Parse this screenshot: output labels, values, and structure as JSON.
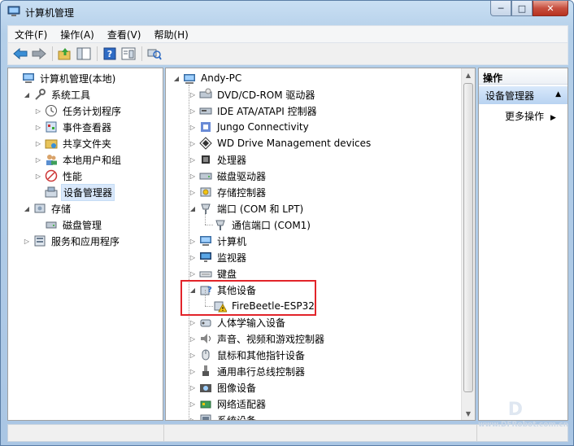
{
  "window": {
    "title": "计算机管理",
    "minimize": "─",
    "maximize": "□",
    "close": "✕"
  },
  "menu": [
    "文件(F)",
    "操作(A)",
    "查看(V)",
    "帮助(H)"
  ],
  "toolbar_icons": [
    "back-arrow-icon",
    "forward-arrow-icon",
    "up-folder-icon",
    "show-hide-tree-icon",
    "help-icon",
    "properties-icon",
    "scan-hardware-icon"
  ],
  "left_tree": [
    {
      "label": "计算机管理(本地)",
      "icon": "computer-management-icon",
      "level": 0,
      "expander": ""
    },
    {
      "label": "系统工具",
      "icon": "system-tools-icon",
      "level": 1,
      "expander": "expanded"
    },
    {
      "label": "任务计划程序",
      "icon": "clock-icon",
      "level": 2,
      "expander": "collapsed"
    },
    {
      "label": "事件查看器",
      "icon": "event-viewer-icon",
      "level": 2,
      "expander": "collapsed"
    },
    {
      "label": "共享文件夹",
      "icon": "shared-folder-icon",
      "level": 2,
      "expander": "collapsed"
    },
    {
      "label": "本地用户和组",
      "icon": "users-icon",
      "level": 2,
      "expander": "collapsed"
    },
    {
      "label": "性能",
      "icon": "performance-icon",
      "level": 2,
      "expander": "collapsed"
    },
    {
      "label": "设备管理器",
      "icon": "device-manager-icon",
      "level": 2,
      "expander": "",
      "selected": true
    },
    {
      "label": "存储",
      "icon": "storage-icon",
      "level": 1,
      "expander": "expanded"
    },
    {
      "label": "磁盘管理",
      "icon": "disk-management-icon",
      "level": 2,
      "expander": ""
    },
    {
      "label": "服务和应用程序",
      "icon": "services-icon",
      "level": 1,
      "expander": "collapsed"
    }
  ],
  "device_tree": {
    "root": "Andy-PC",
    "items": [
      {
        "label": "DVD/CD-ROM 驱动器",
        "icon": "dvd-drive-icon",
        "level": 1,
        "expander": "collapsed"
      },
      {
        "label": "IDE ATA/ATAPI 控制器",
        "icon": "ide-controller-icon",
        "level": 1,
        "expander": "collapsed"
      },
      {
        "label": "Jungo Connectivity",
        "icon": "jungo-icon",
        "level": 1,
        "expander": "collapsed"
      },
      {
        "label": "WD Drive Management devices",
        "icon": "wd-device-icon",
        "level": 1,
        "expander": "collapsed"
      },
      {
        "label": "处理器",
        "icon": "processor-icon",
        "level": 1,
        "expander": "collapsed"
      },
      {
        "label": "磁盘驱动器",
        "icon": "disk-drive-icon",
        "level": 1,
        "expander": "collapsed"
      },
      {
        "label": "存储控制器",
        "icon": "storage-controller-icon",
        "level": 1,
        "expander": "collapsed"
      },
      {
        "label": "端口 (COM 和 LPT)",
        "icon": "port-icon",
        "level": 1,
        "expander": "expanded"
      },
      {
        "label": "通信端口 (COM1)",
        "icon": "com-port-icon",
        "level": 2,
        "expander": ""
      },
      {
        "label": "计算机",
        "icon": "computer-icon",
        "level": 1,
        "expander": "collapsed"
      },
      {
        "label": "监视器",
        "icon": "monitor-icon",
        "level": 1,
        "expander": "collapsed"
      },
      {
        "label": "键盘",
        "icon": "keyboard-icon",
        "level": 1,
        "expander": "collapsed"
      },
      {
        "label": "其他设备",
        "icon": "unknown-device-icon",
        "level": 1,
        "expander": "expanded"
      },
      {
        "label": "FireBeetle-ESP32",
        "icon": "warning-device-icon",
        "level": 2,
        "expander": ""
      },
      {
        "label": "人体学输入设备",
        "icon": "hid-icon",
        "level": 1,
        "expander": "collapsed"
      },
      {
        "label": "声音、视频和游戏控制器",
        "icon": "sound-icon",
        "level": 1,
        "expander": "collapsed"
      },
      {
        "label": "鼠标和其他指针设备",
        "icon": "mouse-icon",
        "level": 1,
        "expander": "collapsed"
      },
      {
        "label": "通用串行总线控制器",
        "icon": "usb-icon",
        "level": 1,
        "expander": "collapsed"
      },
      {
        "label": "图像设备",
        "icon": "camera-icon",
        "level": 1,
        "expander": "collapsed"
      },
      {
        "label": "网络适配器",
        "icon": "network-adapter-icon",
        "level": 1,
        "expander": "collapsed"
      },
      {
        "label": "系统设备",
        "icon": "system-device-icon",
        "level": 1,
        "expander": "collapsed"
      }
    ]
  },
  "actions": {
    "header": "操作",
    "group": "设备管理器",
    "more": "更多操作"
  },
  "watermark": {
    "logo": "D",
    "text": "www.DFRobot.com.cn"
  },
  "colors": {
    "highlight_box": "#e2242a",
    "selection": "#d9e8fb"
  }
}
